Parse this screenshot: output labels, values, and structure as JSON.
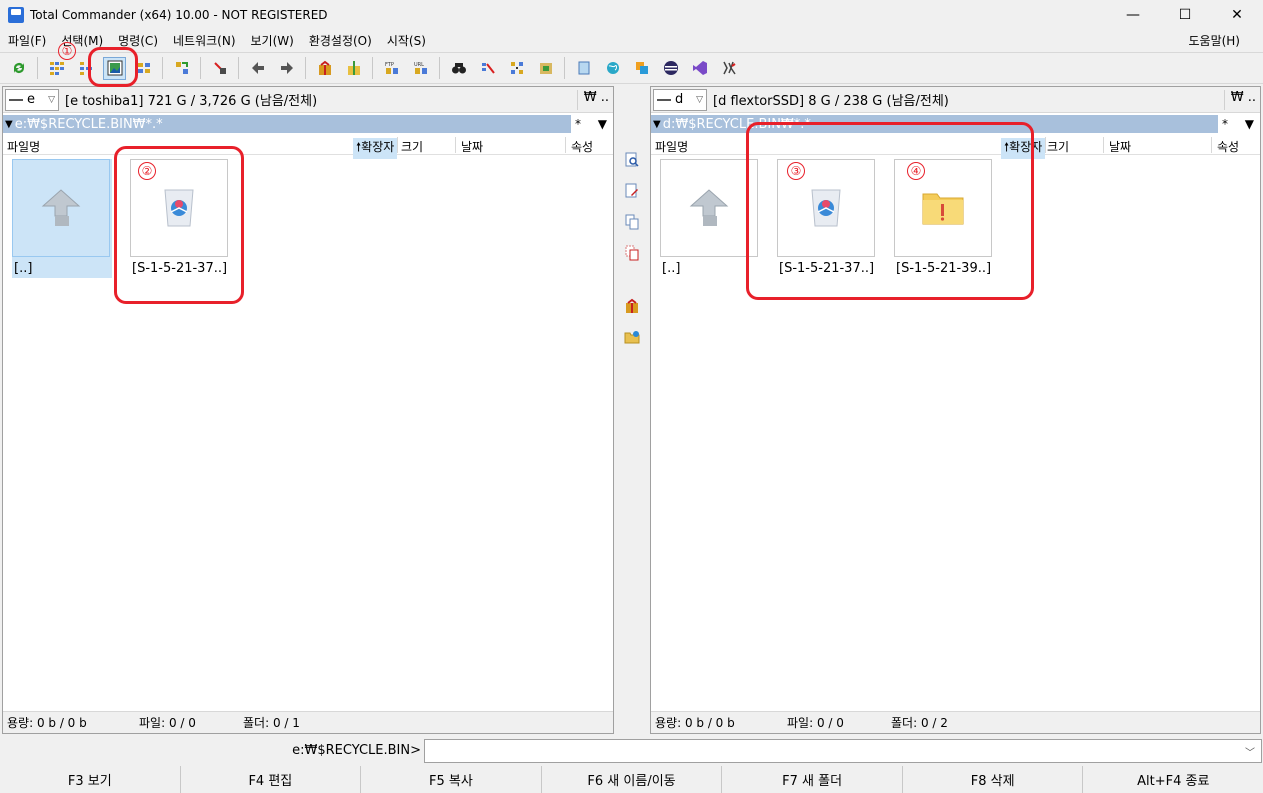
{
  "window": {
    "title": "Total Commander (x64) 10.00 - NOT REGISTERED",
    "minimize": "—",
    "maximize": "☐",
    "close": "✕"
  },
  "menu": {
    "items": [
      "파일(F)",
      "선택(M)",
      "명령(C)",
      "네트워크(N)",
      "보기(W)",
      "환경설정(O)",
      "시작(S)"
    ],
    "help": "도움말(H)"
  },
  "toolbar": {
    "icons": [
      "refresh-icon",
      "brief-view-icon",
      "tree-view-icon",
      "thumbnail-view-icon",
      "compare-icon",
      "sync-icon",
      "invert-selection-icon",
      "back-icon",
      "forward-icon",
      "pack-icon",
      "unpack-icon",
      "ftp-icon",
      "url-icon",
      "search-icon",
      "multi-rename-icon",
      "sync-dirs-icon",
      "disk-icon",
      "notepad-icon",
      "internet-icon",
      "copy-icon",
      "eclipse-icon",
      "visual-studio-icon",
      "tools-icon"
    ]
  },
  "left": {
    "drive": "e",
    "drive_info": "[e toshiba1]  721 G / 3,726 G (남음/전체)",
    "drive_btns": "₩  ..",
    "path": "e:₩$RECYCLE.BIN₩*.*",
    "filter": "*",
    "headers": {
      "name": "파일명",
      "ext": "확장자",
      "size": "크기",
      "date": "날짜",
      "attr": "속성"
    },
    "files": [
      {
        "label": "[..]",
        "type": "up"
      },
      {
        "label": "[S-1-5-21-37..]",
        "type": "recycle"
      }
    ],
    "status": {
      "size": "용량: 0 b / 0 b",
      "files": "파일: 0 / 0",
      "folders": "폴더: 0 / 1"
    }
  },
  "right": {
    "drive": "d",
    "drive_info": "[d flextorSSD]  8 G / 238 G (남음/전체)",
    "drive_btns": "₩  ..",
    "path": "d:₩$RECYCLE.BIN₩*.*",
    "filter": "*",
    "headers": {
      "name": "파일명",
      "ext": "확장자",
      "size": "크기",
      "date": "날짜",
      "attr": "속성"
    },
    "files": [
      {
        "label": "[..]",
        "type": "up"
      },
      {
        "label": "[S-1-5-21-37..]",
        "type": "recycle"
      },
      {
        "label": "[S-1-5-21-39..]",
        "type": "folder"
      }
    ],
    "status": {
      "size": "용량: 0 b / 0 b",
      "files": "파일: 0 / 0",
      "folders": "폴더: 0 / 2"
    }
  },
  "cmdline": {
    "prompt": "e:₩$RECYCLE.BIN>",
    "value": ""
  },
  "fkeys": [
    "F3 보기",
    "F4 편집",
    "F5 복사",
    "F6 새 이름/이동",
    "F7 새 폴더",
    "F8 삭제",
    "Alt+F4 종료"
  ],
  "annotations": [
    "①",
    "②",
    "③",
    "④"
  ],
  "colors": {
    "path_active": "#a8c0dc",
    "selection": "#cce4f7",
    "annotation": "#e8202a"
  }
}
